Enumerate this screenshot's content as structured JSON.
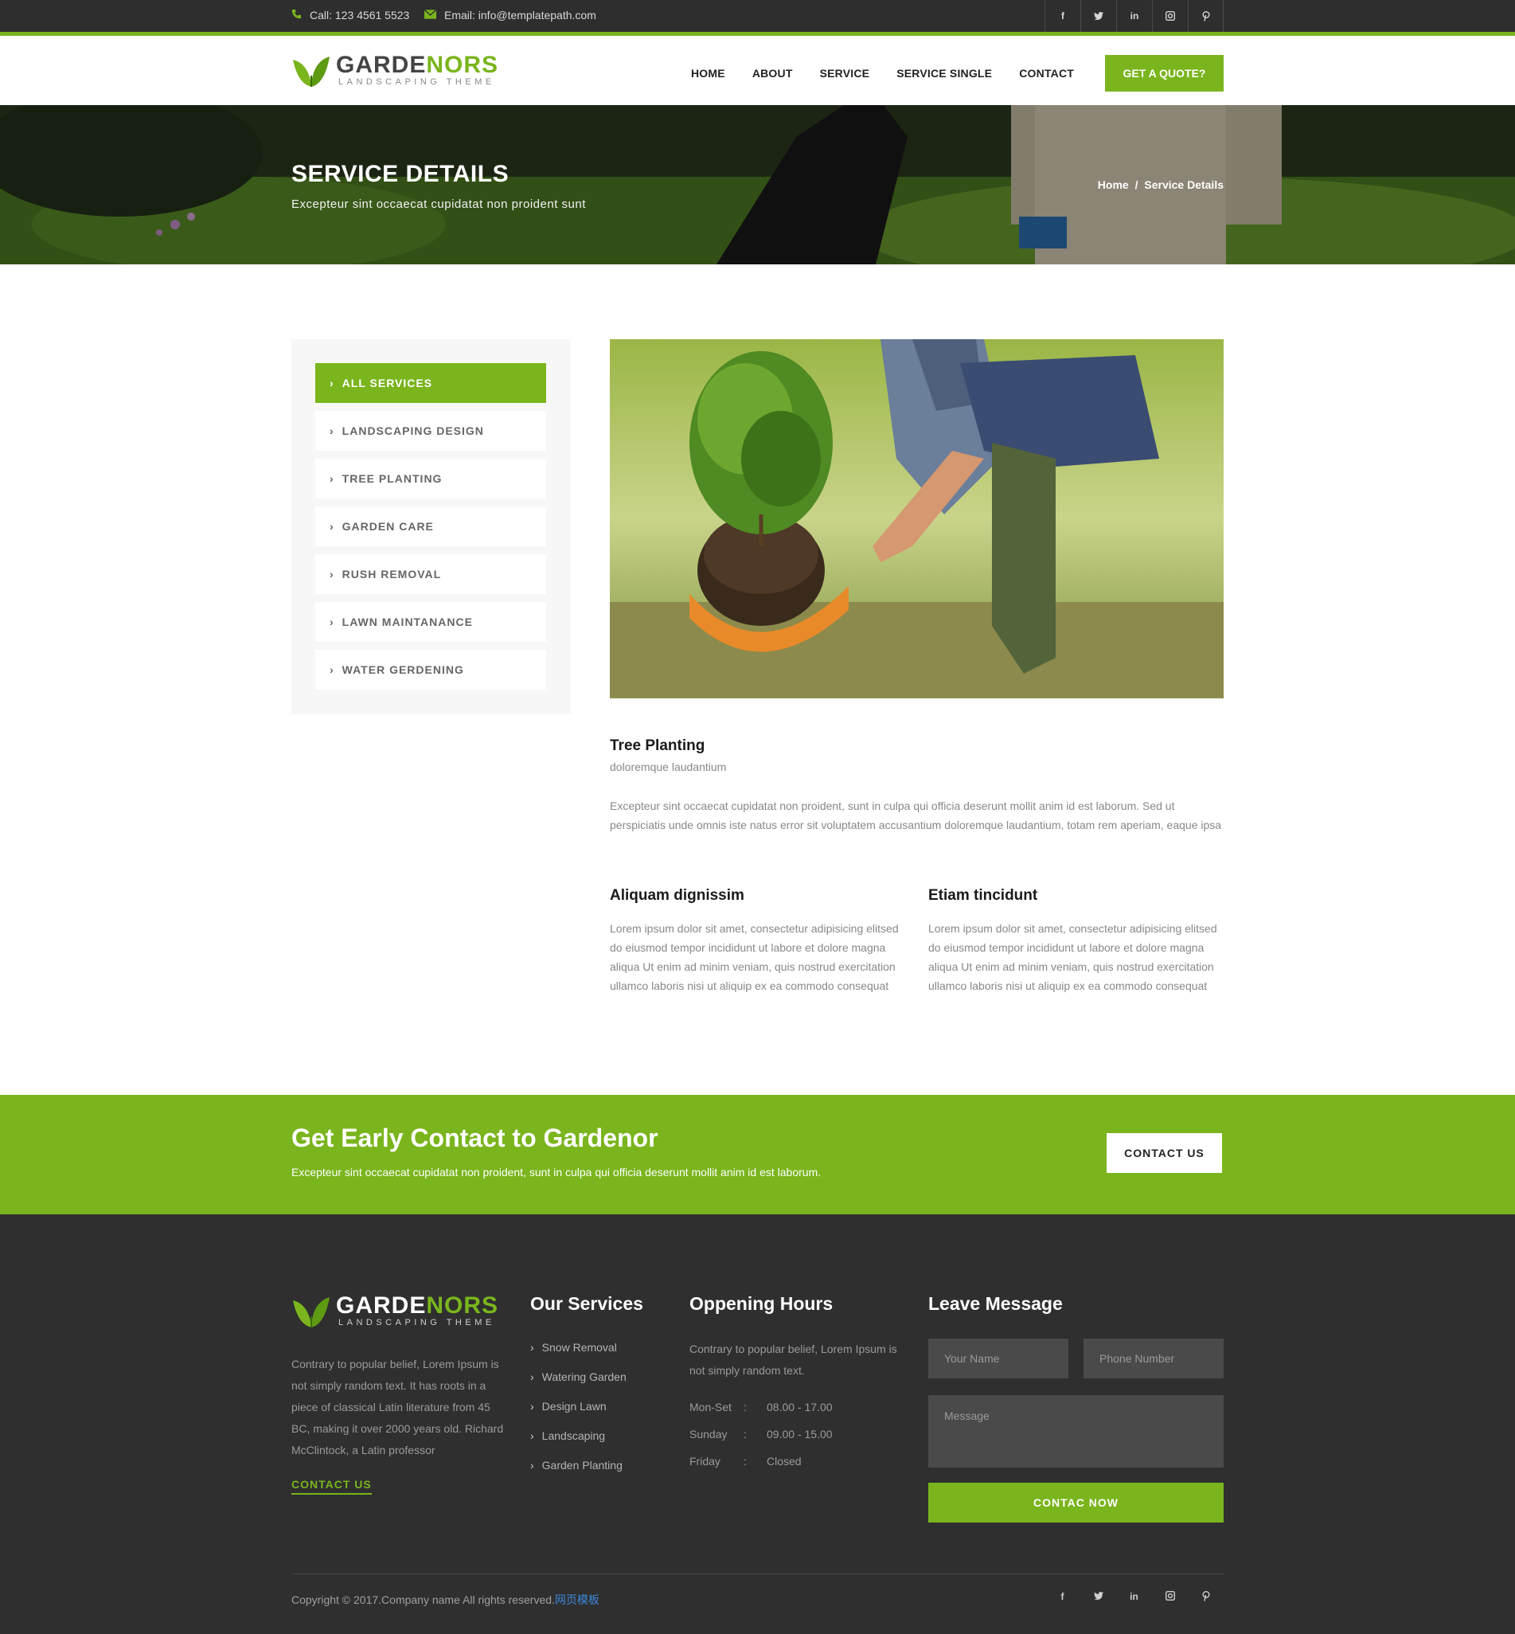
{
  "topbar": {
    "phone": "Call: 123 4561 5523",
    "email": "Email: info@templatepath.com",
    "social": [
      "f",
      "t",
      "in",
      "ig",
      "p"
    ]
  },
  "brand": {
    "name_dark": "GARDE",
    "name_green": "NORS",
    "tagline": "LANDSCAPING THEME"
  },
  "nav": {
    "items": [
      "HOME",
      "ABOUT",
      "SERVICE",
      "SERVICE SINGLE",
      "CONTACT"
    ],
    "quote_button": "GET A QUOTE?"
  },
  "banner": {
    "title": "SERVICE DETAILS",
    "subtitle": "Excepteur sint occaecat cupidatat non proident sunt",
    "breadcrumb_home": "Home",
    "breadcrumb_sep": "/",
    "breadcrumb_current": "Service Details"
  },
  "sidebar": {
    "items": [
      {
        "label": "ALL SERVICES",
        "active": true
      },
      {
        "label": "LANDSCAPING DESIGN",
        "active": false
      },
      {
        "label": "TREE PLANTING",
        "active": false
      },
      {
        "label": "GARDEN CARE",
        "active": false
      },
      {
        "label": "RUSH REMOVAL",
        "active": false
      },
      {
        "label": "LAWN MAINTANANCE",
        "active": false
      },
      {
        "label": "WATER GERDENING",
        "active": false
      }
    ]
  },
  "content": {
    "title": "Tree Planting",
    "subtitle": "doloremque laudantium",
    "intro": "Excepteur sint occaecat cupidatat non proident, sunt in culpa qui officia deserunt mollit anim id est laborum. Sed ut perspiciatis unde omnis iste natus error sit voluptatem accusantium doloremque laudantium, totam rem aperiam, eaque ipsa",
    "col1_title": "Aliquam dignissim",
    "col1_text": "Lorem ipsum dolor sit amet, consectetur adipisicing elitsed do eiusmod tempor incididunt ut labore et dolore magna aliqua Ut enim ad minim veniam, quis nostrud exercitation ullamco laboris nisi ut aliquip ex ea commodo consequat",
    "col2_title": "Etiam tincidunt",
    "col2_text": "Lorem ipsum dolor sit amet, consectetur adipisicing elitsed do eiusmod tempor incididunt ut labore et dolore magna aliqua Ut enim ad minim veniam, quis nostrud exercitation ullamco laboris nisi ut aliquip ex ea commodo consequat"
  },
  "cta": {
    "title": "Get Early Contact to Gardenor",
    "text": "Excepteur sint occaecat cupidatat non proident, sunt in culpa qui officia deserunt mollit anim id est laborum.",
    "button": "CONTACT US"
  },
  "footer": {
    "about_text": "Contrary to popular belief, Lorem Ipsum is not simply random text. It has roots in a piece of classical Latin literature from 45 BC, making it over 2000 years old. Richard McClintock, a Latin professor",
    "about_link": "CONTACT US",
    "services_title": "Our Services",
    "services": [
      "Snow Removal",
      "Watering Garden",
      "Design Lawn",
      "Landscaping",
      "Garden Planting"
    ],
    "hours_title": "Oppening Hours",
    "hours_text": "Contrary to popular belief, Lorem Ipsum is not simply random text.",
    "hours": [
      {
        "day": "Mon-Set",
        "sep": ":",
        "time": "08.00 - 17.00"
      },
      {
        "day": "Sunday",
        "sep": ":",
        "time": "09.00 - 15.00"
      },
      {
        "day": "Friday",
        "sep": ":",
        "time": "Closed"
      }
    ],
    "message_title": "Leave Message",
    "name_placeholder": "Your Name",
    "phone_placeholder": "Phone Number",
    "message_placeholder": "Message",
    "submit": "CONTAC NOW",
    "copyright": "Copyright © 2017.Company name All rights reserved.",
    "copyright_link": "网页模板",
    "social": [
      "f",
      "t",
      "in",
      "ig",
      "p"
    ]
  },
  "colors": {
    "accent": "#7ab51d",
    "dark": "#2e2e2e",
    "footer_bg": "#2f2f2f"
  }
}
